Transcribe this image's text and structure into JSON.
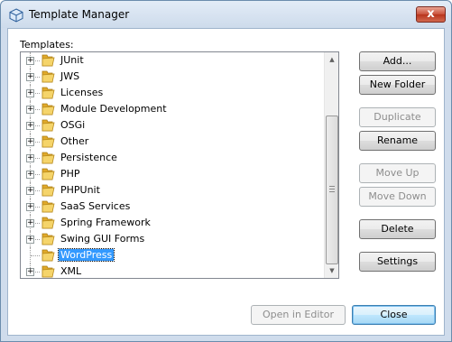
{
  "window": {
    "title": "Template Manager",
    "close_glyph": "x"
  },
  "templates_label": "Templates:",
  "tree": {
    "items": [
      {
        "label": "JUnit",
        "expandable": true,
        "selected": false
      },
      {
        "label": "JWS",
        "expandable": true,
        "selected": false
      },
      {
        "label": "Licenses",
        "expandable": true,
        "selected": false
      },
      {
        "label": "Module Development",
        "expandable": true,
        "selected": false
      },
      {
        "label": "OSGi",
        "expandable": true,
        "selected": false
      },
      {
        "label": "Other",
        "expandable": true,
        "selected": false
      },
      {
        "label": "Persistence",
        "expandable": true,
        "selected": false
      },
      {
        "label": "PHP",
        "expandable": true,
        "selected": false
      },
      {
        "label": "PHPUnit",
        "expandable": true,
        "selected": false
      },
      {
        "label": "SaaS Services",
        "expandable": true,
        "selected": false
      },
      {
        "label": "Spring Framework",
        "expandable": true,
        "selected": false
      },
      {
        "label": "Swing GUI Forms",
        "expandable": true,
        "selected": false
      },
      {
        "label": "WordPress",
        "expandable": false,
        "selected": true
      },
      {
        "label": "XML",
        "expandable": true,
        "selected": false
      }
    ],
    "expander_glyph": "+"
  },
  "buttons": {
    "add": "Add...",
    "new_folder": "New Folder",
    "duplicate": "Duplicate",
    "rename": "Rename",
    "move_up": "Move Up",
    "move_down": "Move Down",
    "delete": "Delete",
    "settings": "Settings",
    "open_in_editor": "Open in Editor",
    "close": "Close"
  },
  "colors": {
    "selection": "#3399ff",
    "folder": "#f2c84b",
    "window_frame": "#cfdcec"
  }
}
